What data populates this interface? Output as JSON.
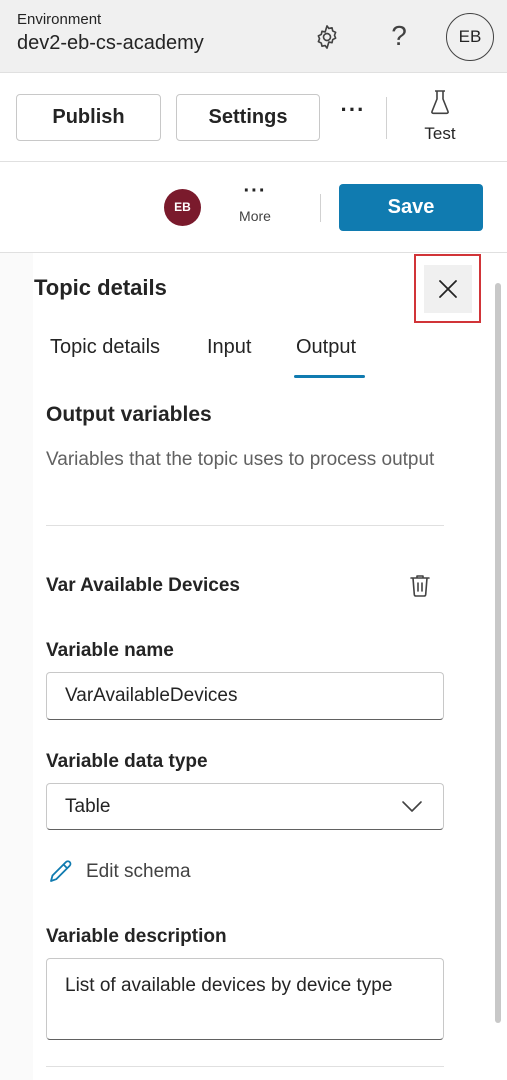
{
  "environment": {
    "label": "Environment",
    "name": "dev2-eb-cs-academy",
    "help_glyph": "?",
    "avatar_initials": "EB",
    "icons": [
      "gear-icon",
      "help-icon"
    ]
  },
  "toolbar": {
    "publish_label": "Publish",
    "settings_label": "Settings",
    "more_glyph": "···",
    "test_label": "Test",
    "icons": [
      "more-icon",
      "flask-icon"
    ]
  },
  "actions": {
    "avatar_initials": "EB",
    "more_glyph": "···",
    "more_label": "More",
    "save_label": "Save",
    "colors": {
      "save": "#107bb0",
      "avatar": "#7a1a2c"
    }
  },
  "panel": {
    "title": "Topic details",
    "close_icon": "close-icon",
    "tabs": [
      {
        "label": "Topic details",
        "selected": false
      },
      {
        "label": "Input",
        "selected": false
      },
      {
        "label": "Output",
        "selected": true
      }
    ],
    "section": {
      "title": "Output variables",
      "description": "Variables that the topic uses to process output"
    },
    "variable": {
      "header": "Var Available Devices",
      "delete_icon": "trash-icon",
      "name_label": "Variable name",
      "name_value": "VarAvailableDevices",
      "type_label": "Variable data type",
      "type_value": "Table",
      "edit_schema_label": "Edit schema",
      "description_label": "Variable description",
      "description_value": "List of available devices by device type"
    },
    "colors": {
      "accent": "#107bb0",
      "highlight_border": "#d13438"
    }
  }
}
